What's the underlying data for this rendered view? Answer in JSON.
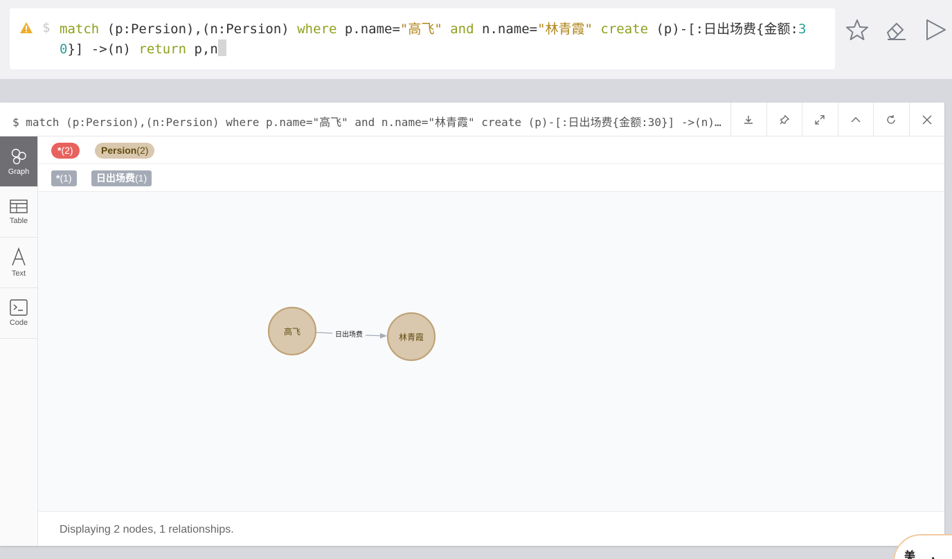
{
  "editor": {
    "prompt": "$",
    "query": {
      "t1": "match",
      "t2": " (p:Persion),(n:Persion) ",
      "t3": "where",
      "t4": " p.name=",
      "t5": "\"高飞\"",
      "t6": " and",
      "t7": " n.name=",
      "t8": "\"林青霞\"",
      "t9": " create",
      "t10": " (p)-[:日出场费{金额:",
      "t11": "30",
      "t12": "}] ->(n) ",
      "t13": "return",
      "t14": " p,n"
    }
  },
  "frame": {
    "title": "$ match (p:Persion),(n:Persion) where p.name=\"高飞\" and n.name=\"林青霞\" create (p)-[:日出场费{金额:30}] ->(n) return p,n"
  },
  "sidebar": {
    "items": [
      {
        "label": "Graph",
        "icon": "graph-icon",
        "active": true
      },
      {
        "label": "Table",
        "icon": "table-icon"
      },
      {
        "label": "Text",
        "icon": "text-icon"
      },
      {
        "label": "Code",
        "icon": "code-icon"
      }
    ]
  },
  "legend": {
    "node_labels": [
      {
        "name": "*",
        "count": "(2)",
        "color": "#e8625d",
        "text_color": "#ffffff"
      },
      {
        "name": "Persion",
        "count": "(2)",
        "color": "#d9c8ae",
        "text_color": "#604a0e"
      }
    ],
    "rel_types": [
      {
        "name": "*",
        "count": "(1)"
      },
      {
        "name": "日出场费",
        "count": "(1)"
      }
    ]
  },
  "graph": {
    "nodes": [
      {
        "label": "高飞"
      },
      {
        "label": "林青霞"
      }
    ],
    "relationship": {
      "label": "日出场费"
    },
    "node_fill": "#d9c8ae",
    "node_stroke": "#c0a378"
  },
  "status": {
    "text": "Displaying 2 nodes, 1 relationships."
  },
  "seal": {
    "text": "美 ， 同"
  }
}
